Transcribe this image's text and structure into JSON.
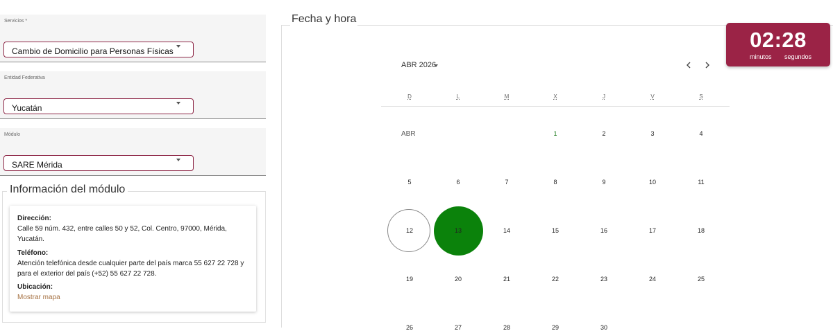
{
  "form": {
    "servicios": {
      "label": "Servicios *",
      "value": "Cambio de Domicilio para Personas Físicas"
    },
    "entidad": {
      "label": "Entidad Federativa",
      "value": "Yucatán"
    },
    "modulo": {
      "label": "Módulo",
      "value": "SARE Mérida"
    }
  },
  "module_info": {
    "title": "Información del módulo",
    "direccion_label": "Dirección:",
    "direccion_line1": "Calle 59 núm. 432, entre calles 50 y 52, Col. Centro, 97000, Mérida,",
    "direccion_line2": "Yucatán.",
    "telefono_label": "Teléfono:",
    "telefono_line1": "Atención telefónica desde cualquier parte del país marca 55 627 22 728 y",
    "telefono_line2": "para el exterior del país (+52) 55 627 22 728.",
    "ubicacion_label": "Ubicación:",
    "map_link": "Mostrar mapa"
  },
  "calendar": {
    "title": "Fecha y hora",
    "month_selector": "ABR 2026",
    "month_label": "ABR",
    "weekdays": [
      "D",
      "L",
      "M",
      "X",
      "J",
      "V",
      "S"
    ],
    "days": [
      "1",
      "2",
      "3",
      "4",
      "5",
      "6",
      "7",
      "8",
      "9",
      "10",
      "11",
      "12",
      "13",
      "14",
      "15",
      "16",
      "17",
      "18",
      "19",
      "20",
      "21",
      "22",
      "23",
      "24",
      "25",
      "26",
      "27",
      "28",
      "29",
      "30"
    ],
    "today": "12",
    "selected": "13",
    "available": [
      "1"
    ],
    "colors": {
      "selected": "#0b820b",
      "accent": "#9b2346"
    }
  },
  "timer": {
    "time": "02:28",
    "unit_minutes": "minutos",
    "unit_seconds": "segundos"
  }
}
